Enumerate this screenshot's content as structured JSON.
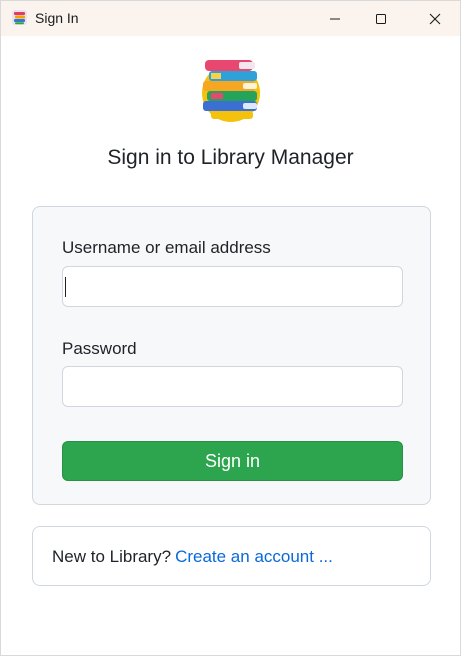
{
  "window": {
    "title": "Sign In",
    "controls": [
      "minimize",
      "maximize",
      "close"
    ]
  },
  "page": {
    "heading": "Sign in to Library Manager"
  },
  "login_form": {
    "username_label": "Username or email address",
    "username_value": "",
    "password_label": "Password",
    "password_value": "",
    "submit_label": "Sign in"
  },
  "signup": {
    "prompt": "New to Library?",
    "link_text": "Create an account ..."
  },
  "colors": {
    "titlebar": "#fbf3ee",
    "primary_button": "#2da44e",
    "link": "#0969da",
    "panel_background": "#f6f8fa",
    "border": "#d0d7de"
  },
  "icons": {
    "app": "books-icon",
    "logo": "books-stack-logo"
  }
}
